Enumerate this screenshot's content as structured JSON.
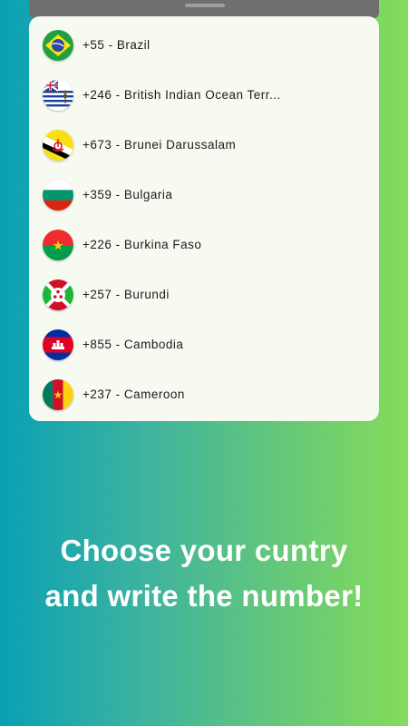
{
  "countries": [
    {
      "label": "+55 - Brazil",
      "icon": "brazil-flag-icon"
    },
    {
      "label": "+246 - British Indian Ocean Terr...",
      "icon": "british-indian-ocean-territory-flag-icon"
    },
    {
      "label": "+673 - Brunei Darussalam",
      "icon": "brunei-flag-icon"
    },
    {
      "label": "+359 - Bulgaria",
      "icon": "bulgaria-flag-icon"
    },
    {
      "label": "+226 - Burkina Faso",
      "icon": "burkina-faso-flag-icon"
    },
    {
      "label": "+257 - Burundi",
      "icon": "burundi-flag-icon"
    },
    {
      "label": "+855 - Cambodia",
      "icon": "cambodia-flag-icon"
    },
    {
      "label": "+237 - Cameroon",
      "icon": "cameroon-flag-icon"
    }
  ],
  "tagline": {
    "line1": "Choose your cuntry",
    "line2": "and write the number!"
  },
  "colors": {
    "gradient_start": "#0aa0b4",
    "gradient_end": "#84dc5a",
    "sheet_background": "#f6faf1",
    "text": "#1c1c1c"
  }
}
